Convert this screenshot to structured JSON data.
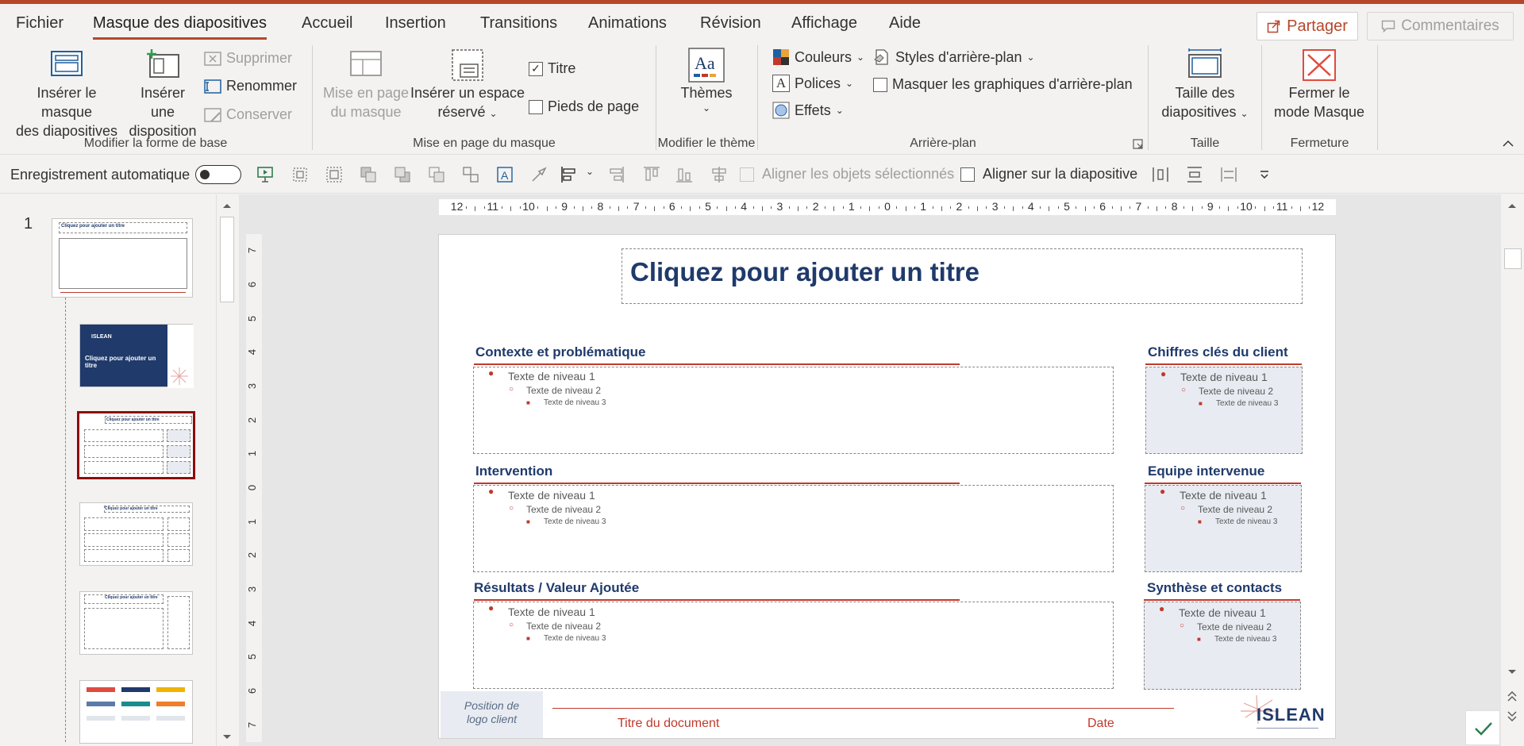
{
  "menu": {
    "tabs": [
      "Fichier",
      "Masque des diapositives",
      "Accueil",
      "Insertion",
      "Transitions",
      "Animations",
      "Révision",
      "Affichage",
      "Aide"
    ],
    "active_tab": "Masque des diapositives",
    "share_label": "Partager",
    "comments_label": "Commentaires"
  },
  "ribbon": {
    "groups": {
      "base": "Modifier la forme de base",
      "layout": "Mise en page du masque",
      "theme": "Modifier le thème",
      "background": "Arrière-plan",
      "size": "Taille",
      "close": "Fermeture"
    },
    "insert_master_1": "Insérer le masque",
    "insert_master_2": "des diapositives",
    "insert_layout_1": "Insérer une",
    "insert_layout_2": "disposition",
    "delete": "Supprimer",
    "rename": "Renommer",
    "preserve": "Conserver",
    "master_layout_1": "Mise en page",
    "master_layout_2": "du masque",
    "insert_placeholder_1": "Insérer un espace",
    "insert_placeholder_2": "réservé",
    "title_check": "Titre",
    "footer_check": "Pieds de page",
    "themes": "Thèmes",
    "colors": "Couleurs",
    "fonts": "Polices",
    "effects": "Effets",
    "bg_styles": "Styles d'arrière-plan",
    "hide_bg": "Masquer les graphiques d'arrière-plan",
    "slide_size_1": "Taille des",
    "slide_size_2": "diapositives",
    "close_master_1": "Fermer le",
    "close_master_2": "mode Masque"
  },
  "quickbar": {
    "autosave": "Enregistrement automatique",
    "align_selected": "Aligner les objets sélectionnés",
    "align_slide": "Aligner sur la diapositive"
  },
  "thumbs": {
    "number": "1",
    "thumb1_title": "Cliquez pour ajouter un titre",
    "thumb2_brand": "ISLEAN",
    "thumb2_title": "Cliquez pour ajouter un titre",
    "thumb3_title": "Cliquez pour ajouter un titre",
    "thumb4_title": "Cliquez pour ajouter un titre",
    "thumb5_title": "Cliquez pour ajouter un titre"
  },
  "ruler": {
    "h_ticks": [
      "12",
      "11",
      "10",
      "9",
      "8",
      "7",
      "6",
      "5",
      "4",
      "3",
      "2",
      "1",
      "0",
      "1",
      "2",
      "3",
      "4",
      "5",
      "6",
      "7",
      "8",
      "9",
      "10",
      "11",
      "12"
    ],
    "v_ticks": [
      "7",
      "6",
      "5",
      "4",
      "3",
      "2",
      "1",
      "0",
      "1",
      "2",
      "3",
      "4",
      "5",
      "6",
      "7"
    ]
  },
  "slide": {
    "title": "Cliquez pour ajouter un titre",
    "sections": [
      {
        "title": "Contexte et problématique"
      },
      {
        "title": "Chiffres clés du client"
      },
      {
        "title": "Intervention"
      },
      {
        "title": "Equipe intervenue"
      },
      {
        "title": "Résultats / Valeur Ajoutée"
      },
      {
        "title": "Synthèse et contacts"
      }
    ],
    "level1": "Texte de niveau 1",
    "level2": "Texte de niveau 2",
    "level3": "Texte de niveau 3",
    "logo_client_1": "Position de",
    "logo_client_2": "logo client",
    "doc_title": "Titre du document",
    "date": "Date",
    "brand": "ISLEAN"
  },
  "colors": {
    "accent": "#b7472a",
    "brand_blue": "#1f3a6b",
    "brand_red": "#c0392b"
  }
}
